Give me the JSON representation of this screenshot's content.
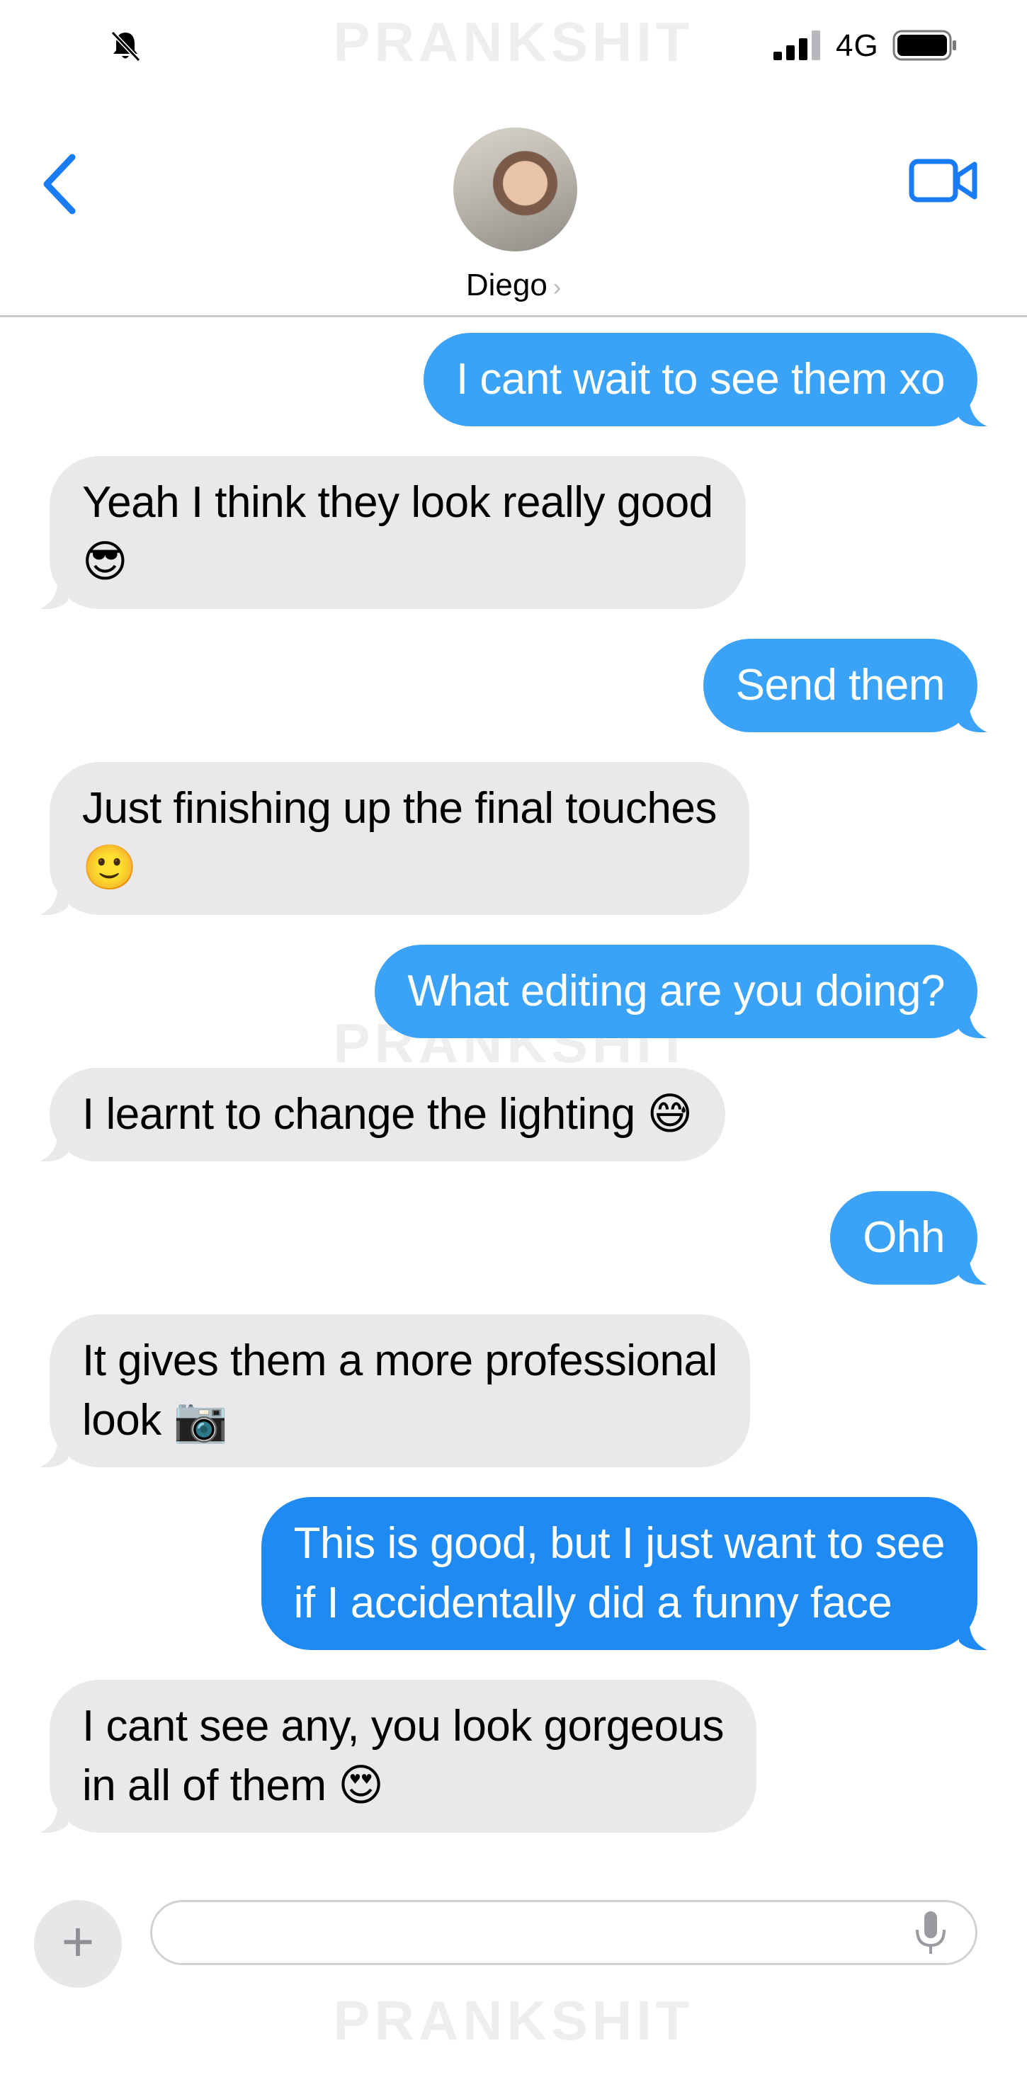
{
  "status_bar": {
    "network": "4G",
    "icons": [
      "bell-muted-icon",
      "signal-icon",
      "battery-icon"
    ]
  },
  "watermark": "PRANKSHIT",
  "header": {
    "contact_name": "Diego",
    "chevron": "›",
    "icons": [
      "back-chevron-icon",
      "video-camera-icon",
      "avatar"
    ]
  },
  "messages": [
    {
      "direction": "outgoing",
      "text": "I cant wait to see them xo"
    },
    {
      "direction": "incoming",
      "text": "Yeah I think they look really good\n😎"
    },
    {
      "direction": "outgoing",
      "text": "Send them"
    },
    {
      "direction": "incoming",
      "text": "Just finishing up the final touches\n🙂"
    },
    {
      "direction": "outgoing",
      "text": "What editing are you doing?"
    },
    {
      "direction": "incoming",
      "text": "I learnt to change the lighting 😅"
    },
    {
      "direction": "outgoing",
      "text": "Ohh"
    },
    {
      "direction": "incoming",
      "text": "It gives them a more professional\nlook 📷"
    },
    {
      "direction": "outgoing",
      "text": "This is good, but I just want to see\nif I accidentally did a funny face"
    },
    {
      "direction": "incoming",
      "text": "I cant see any, you look gorgeous\nin all of them 😍"
    }
  ],
  "input_bar": {
    "plus_label": "+",
    "input_value": "",
    "icons": [
      "plus-icon",
      "microphone-icon"
    ]
  },
  "colors": {
    "outgoing_light": "#3aa2f7",
    "outgoing_dark": "#1f8bf2",
    "incoming": "#e9e9eb",
    "accent": "#1a7cf5"
  }
}
